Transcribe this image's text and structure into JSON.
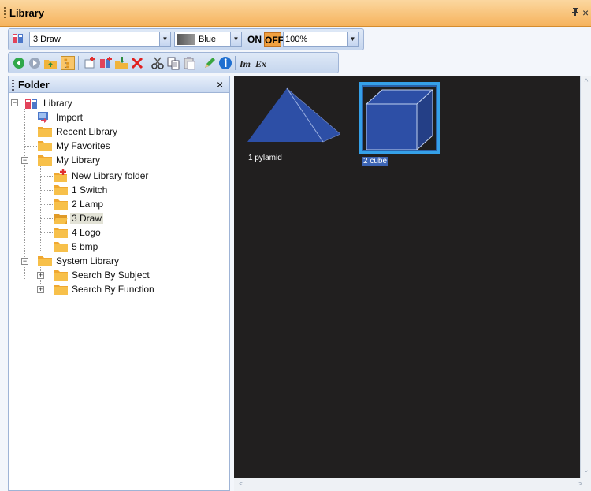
{
  "window": {
    "title": "Library",
    "pin_glyph": "4",
    "close_glyph": "×"
  },
  "toolbar": {
    "library_combo_value": "3 Draw",
    "color_combo_value": "Blue",
    "on_label": "ON",
    "off_label": "OFF",
    "zoom_value": "100%"
  },
  "folder_panel": {
    "title": "Folder",
    "close_glyph": "×"
  },
  "tree": {
    "root": "Library",
    "import": "Import",
    "recent": "Recent Library",
    "favorites": "My Favorites",
    "my_library": "My Library",
    "new_folder": "New Library folder",
    "f1": "1 Switch",
    "f2": "2 Lamp",
    "f3": "3 Draw",
    "f4": "4 Logo",
    "f5": "5 bmp",
    "system_library": "System Library",
    "by_subject": "Search By Subject",
    "by_function": "Search By Function"
  },
  "items": [
    {
      "label": "1 pylamid",
      "shape": "pyramid"
    },
    {
      "label": "2 cube",
      "shape": "cube",
      "selected": true
    }
  ],
  "colors": {
    "title_bar": "#f6b35d",
    "preview_bg": "#211f1f",
    "shape_blue": "#2d4fa6",
    "selection": "#35a0e8"
  }
}
